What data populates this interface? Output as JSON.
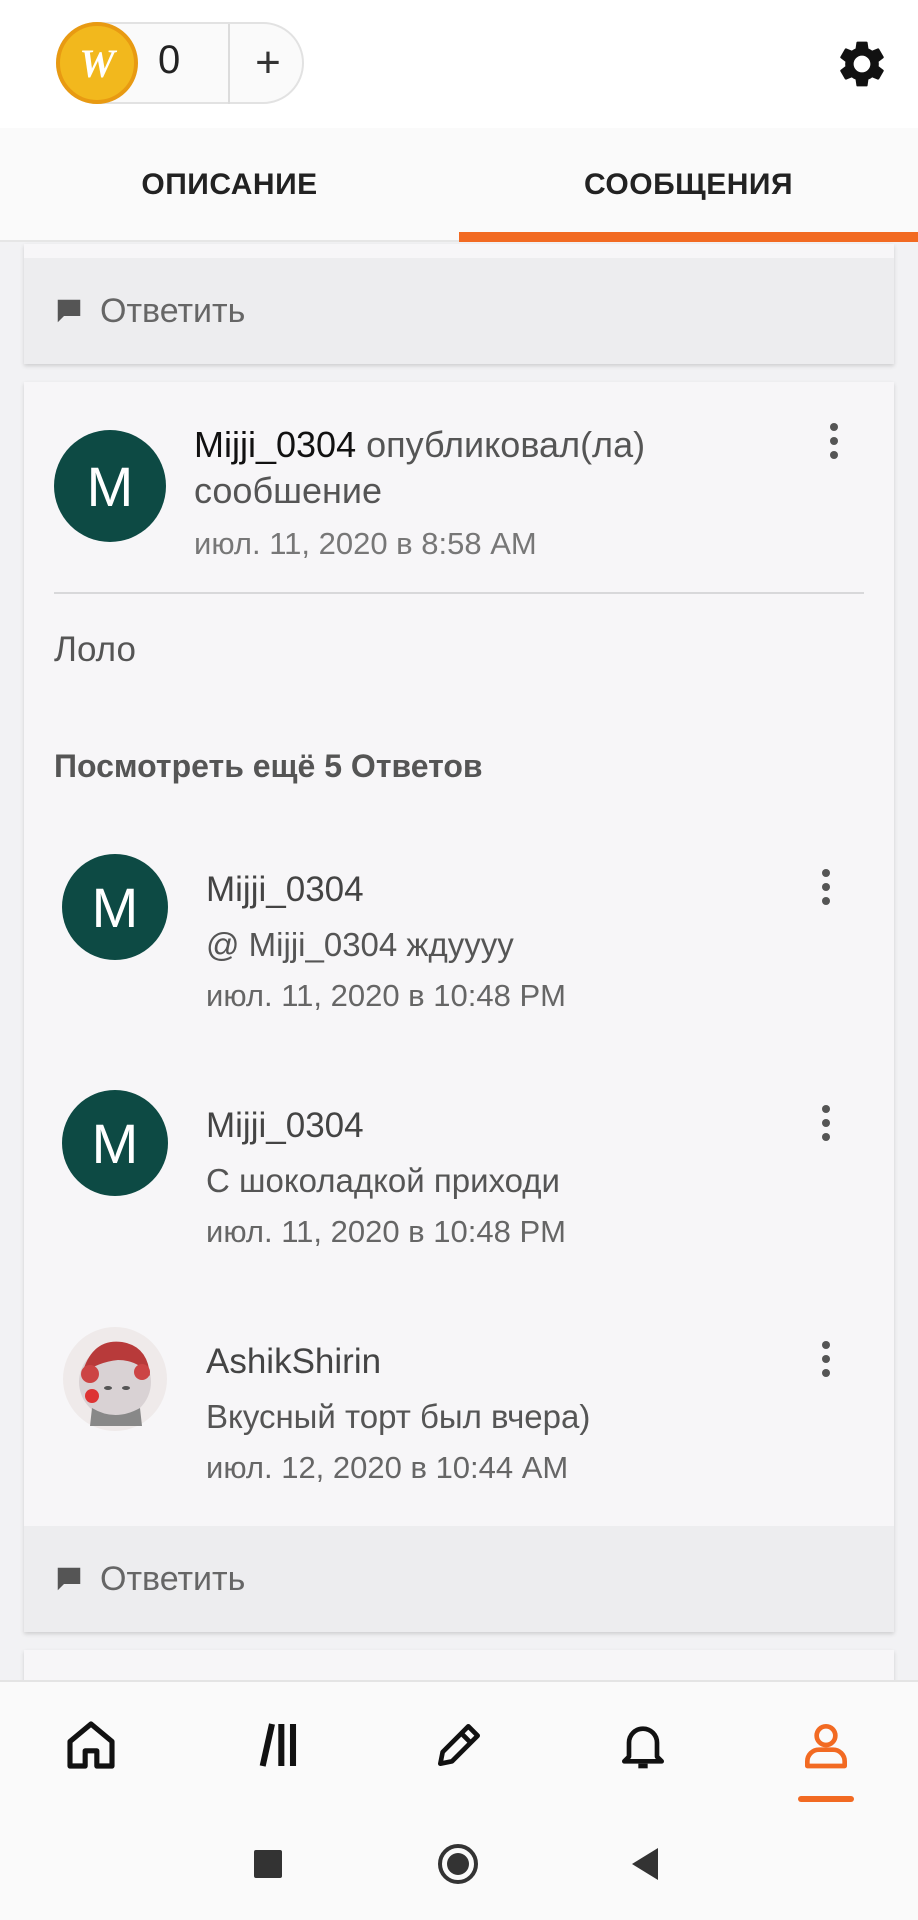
{
  "header": {
    "coin_count": "0",
    "add_label": "+",
    "coin_letter": "W"
  },
  "tabs": [
    {
      "label": "ОПИСАНИЕ",
      "active": false
    },
    {
      "label": "СООБЩЕНИЯ",
      "active": true
    }
  ],
  "accent_color": "#f26a22",
  "top_reply_bar": {
    "label": "Ответить"
  },
  "post": {
    "author": "Mijji_0304",
    "action": "опубликовал(ла)",
    "action_line2": "сообшение",
    "timestamp": "июл. 11, 2020 в 8:58 AM",
    "avatar_letter": "M",
    "body": "Лоло",
    "view_more": "Посмотреть ещё 5 Ответов",
    "replies": [
      {
        "author": "Mijji_0304",
        "text": "@ Mijji_0304  ждуууу",
        "timestamp": "июл. 11, 2020 в 10:48 PM",
        "avatar_letter": "M"
      },
      {
        "author": "Mijji_0304",
        "text": "С шоколадкой приходи",
        "timestamp": "июл. 11, 2020 в 10:48 PM",
        "avatar_letter": "M"
      },
      {
        "author": "AshikShirin",
        "text": "Вкусный торт был вчера)",
        "timestamp": "июл. 12, 2020 в 10:44 AM",
        "avatar_letter": ""
      }
    ],
    "reply_label": "Ответить"
  },
  "bottom_nav": [
    {
      "icon": "home-icon",
      "active": false
    },
    {
      "icon": "library-icon",
      "active": false
    },
    {
      "icon": "pencil-icon",
      "active": false
    },
    {
      "icon": "bell-icon",
      "active": false
    },
    {
      "icon": "profile-icon",
      "active": true
    }
  ]
}
